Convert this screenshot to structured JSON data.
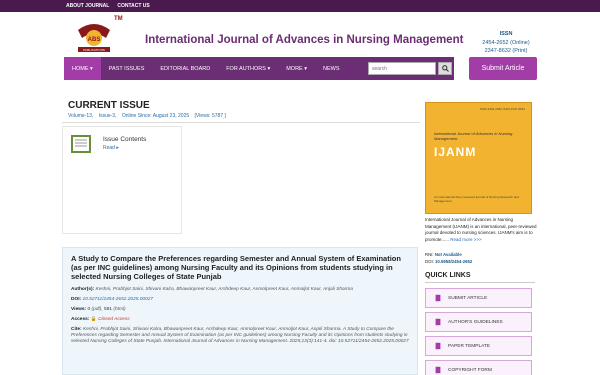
{
  "topbar": {
    "about": "ABOUT JOURNAL",
    "contact": "CONTACT US"
  },
  "header": {
    "title": "International Journal of Advances in Nursing Management",
    "logo_text": "ABS PUBLICATIONS",
    "logo_tm": "TM",
    "issn_label": "ISSN",
    "issn_online": "2454-2652 (Online)",
    "issn_print": "2347-8632 (Print)"
  },
  "nav": {
    "items": [
      "HOME ▾",
      "PAST ISSUES",
      "EDITORIAL BOARD",
      "FOR AUTHORS ▾",
      "MORE ▾",
      "NEWS"
    ],
    "search_placeholder": "search",
    "submit": "Submit Article"
  },
  "current_issue": {
    "heading": "CURRENT ISSUE",
    "volume": "Volume-13,",
    "issue": "Issue-3,",
    "online_since": "Online Since: August 23, 2025",
    "views": "[Views: 5787 ]",
    "card_title": "Issue Contents",
    "card_read": "Read ▸"
  },
  "article": {
    "title": "A Study to Compare the Preferences regarding Semester and Annual System of Examination (as per INC guidelines) among Nursing Faculty and its Opinions from students studying in selected Nursing Colleges of State Punjab",
    "authors_label": "Author(s):",
    "authors": "Keshni, Prabhjot Saini, Shivani Kalra, Bhawanpreet Kaur, Arshdeep Kaur, Anmolpreet Kaur, Anmoljot Kaur, Anjali Sharma",
    "doi_label": "DOI:",
    "doi": "10.52711/2454-2652.2025.00027",
    "views_label": "Views:",
    "views_pdf": "0",
    "views_pdf_unit": "(pdf),",
    "views_html": "581",
    "views_html_unit": "(html)",
    "access_label": "Access:",
    "access": "Closed Access",
    "cite_label": "Cite:",
    "cite": "Keshni, Prabhjot Saini, Shivani Kalra, Bhawanpreet Kaur, Arshdeep Kaur, Anmolpreet Kaur, Anmoljot Kaur, Anjali Sharma. A Study to Compare the Preferences regarding Semester and Annual System of Examination (as per INC guidelines) among Nursing Faculty and its Opinions from students studying in selected Nursing Colleges of State Punjab. International Journal of Advances in Nursing Management. 2025;13(3):141-4. doi: 10.52711/2454-2652.2025.00027"
  },
  "sidebar": {
    "cover_small": "ISSN 2454-2652\nISSN 2347-8632",
    "cover_title": "International Journal of Advances in Nursing Management",
    "cover_abbr": "IJANM",
    "cover_foot": "An international Peer-reviewed journal of Nursing Research and Management",
    "desc": "International Journal of Advances in Nursing Management (IJANM) is an international, peer-reviewed journal devoted to nursing sciences. IJANM's aim is to promote......",
    "read_more": "Read more >>>",
    "rni_label": "RNI:",
    "rni": "Not Available",
    "doi_label": "DOI:",
    "doi": "10.5958/2454-2652",
    "quick_links_title": "QUICK LINKS",
    "quick_links": [
      "SUBMIT ARTICLE",
      "AUTHOR'S GUIDELINES",
      "PAPER TEMPLATE",
      "COPYRIGHT FORM"
    ]
  },
  "colors": {
    "brand": "#6b2d73",
    "accent": "#a23ca6",
    "topbar": "#4a1a4e",
    "link": "#2a6ba8"
  }
}
